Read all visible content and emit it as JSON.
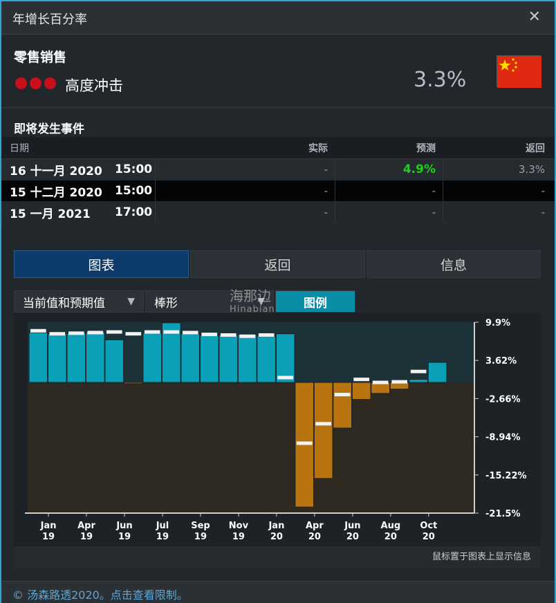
{
  "window": {
    "title": "年增长百分率"
  },
  "indicator": {
    "name": "零售销售",
    "impact_label": "高度冲击",
    "impact_level": 3,
    "value": "3.3%",
    "flag": "china-flag-icon"
  },
  "events": {
    "header": "即将发生事件",
    "columns": {
      "date": "日期",
      "actual": "实际",
      "forecast": "预测",
      "previous": "返回"
    },
    "rows": [
      {
        "date": "16 十一月 2020",
        "time": "15:00",
        "actual": "-",
        "forecast": "4.9%",
        "previous": "3.3%"
      },
      {
        "date": "15 十二月 2020",
        "time": "15:00",
        "actual": "-",
        "forecast": "-",
        "previous": "-"
      },
      {
        "date": "15 一月 2021",
        "time": "17:00",
        "actual": "-",
        "forecast": "-",
        "previous": "-"
      }
    ]
  },
  "tabs": [
    {
      "label": "图表",
      "active": true
    },
    {
      "label": "返回",
      "active": false
    },
    {
      "label": "信息",
      "active": false
    }
  ],
  "controls": {
    "series_select": "当前值和预期值",
    "type_select": "棒形",
    "legend_button": "图例"
  },
  "watermark": {
    "cn": "海那边",
    "en": "Hinabian"
  },
  "chart_data": {
    "type": "bar",
    "y_ticks": [
      "9.9%",
      "3.62%",
      "-2.66%",
      "-8.94%",
      "-15.22%",
      "-21.5%"
    ],
    "ylim": [
      -21.5,
      9.9
    ],
    "x_ticks": [
      {
        "month": "Jan",
        "year": "19",
        "index": 0
      },
      {
        "month": "Apr",
        "year": "19",
        "index": 2
      },
      {
        "month": "Jun",
        "year": "19",
        "index": 4
      },
      {
        "month": "Jul",
        "year": "19",
        "index": 6
      },
      {
        "month": "Sep",
        "year": "19",
        "index": 8
      },
      {
        "month": "Nov",
        "year": "19",
        "index": 10
      },
      {
        "month": "Jan",
        "year": "20",
        "index": 12
      },
      {
        "month": "Apr",
        "year": "20",
        "index": 14
      },
      {
        "month": "Jun",
        "year": "20",
        "index": 16
      },
      {
        "month": "Aug",
        "year": "20",
        "index": 18
      },
      {
        "month": "Oct",
        "year": "20",
        "index": 20
      }
    ],
    "series": [
      {
        "values": [
          8.2,
          8.0,
          8.1,
          8.3,
          7.0,
          -0.2,
          8.1,
          9.8,
          8.0,
          7.7,
          7.8,
          7.9,
          7.6,
          8.0,
          -20.5,
          -15.8,
          -7.5,
          -2.8,
          -1.8,
          -1.1,
          0.5,
          3.3
        ]
      },
      {
        "values": [
          8.5,
          8.0,
          8.1,
          8.2,
          8.3,
          8.0,
          8.3,
          8.3,
          8.2,
          7.9,
          7.8,
          7.6,
          7.8,
          0.8,
          -10.0,
          -6.8,
          -2.0,
          0.5,
          0.0,
          0.1,
          1.8
        ]
      }
    ]
  },
  "chart_hint": "鼠标置于图表上显示信息",
  "footer": {
    "copyright": "© 汤森路透2020。点击查看限制。"
  },
  "colors": {
    "positive_bar": "#0aa0b8",
    "negative_bar": "#b87410",
    "forecast_marker": "#f2f2f2",
    "forecast_green": "#19d219",
    "active_tab": "#0c3b6c",
    "border_accent": "#2ea7d6"
  }
}
